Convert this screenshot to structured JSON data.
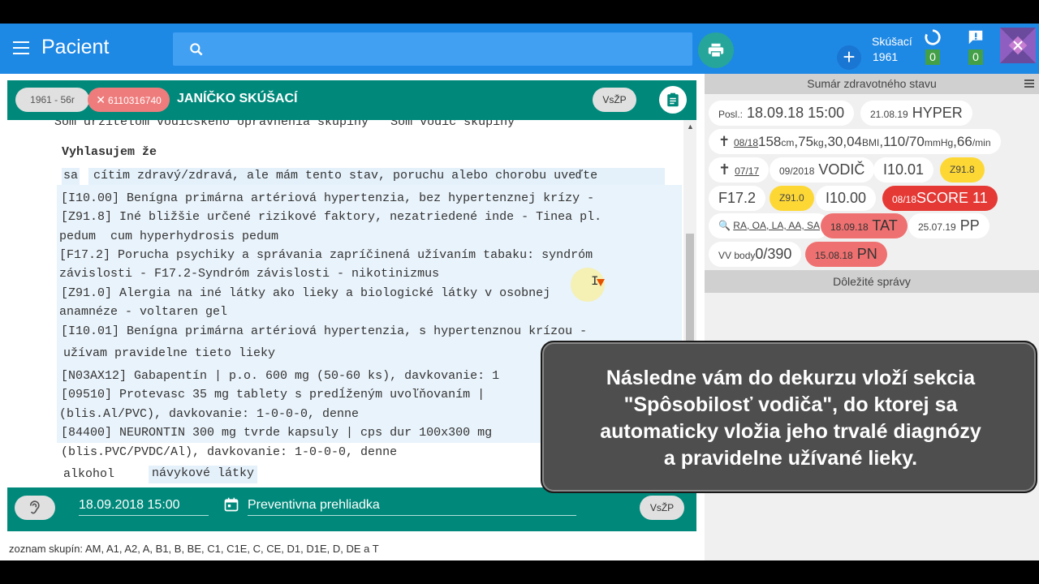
{
  "appbar": {
    "title": "Pacient",
    "add_label": "+",
    "user_name": "Skúšací",
    "user_id": "1961",
    "sync_count": "0",
    "message_count": "0",
    "icons": [
      "menu-icon",
      "search-icon",
      "print-icon",
      "sync-icon",
      "message-alert-icon",
      "app-logo"
    ]
  },
  "patient": {
    "age_chip": "1961 - 56r",
    "id_chip": "6110316740",
    "name": "JANÍČKO SKÚŠACÍ",
    "insurer": "VsŽP"
  },
  "editor": {
    "line_top": "Som držiteľom vodičského oprávnenia skupiny   Som vodič skupiny",
    "heading": "Vyhlasujem že",
    "sa": "sa",
    "feel": "cítim zdravý/zdravá, ale mám tento stav, poruchu alebo chorobu uveďte",
    "diag_lines": [
      "[I10.00] Benígna primárna artériová hypertenzia, bez hypertenznej krízy -",
      "[Z91.8] Iné bližšie určené rizikové faktory, nezatriedené inde - Tinea pl.",
      "pedum  cum hyperhydrosis pedum",
      "[F17.2] Porucha psychiky a správania zapríčinená užívaním tabaku: syndróm",
      "závislosti - F17.2-Syndróm závislosti - nikotinizmus",
      "[Z91.0] Alergia na iné látky ako lieky a biologické látky v osobnej",
      "anamnéze - voltaren gel",
      "[I10.01] Benígna primárna artériová hypertenzia, s hypertenznou krízou -"
    ],
    "regular_meds": "užívam pravidelne tieto lieky",
    "med_lines": [
      "[N03AX12] Gabapentín | p.o. 600 mg (50-60 ks), davkovanie: 1",
      "[09510] Protevasc 35 mg tablety s predĺženým uvoľňovaním |",
      "(blis.Al/PVC), davkovanie: 1-0-0-0, denne",
      "[84400] NEURONTIN 300 mg tvrde kapsuly | cps dur 100x300 mg",
      "(blis.PVC/PVDC/Al), davkovanie: 1-0-0-0, denne"
    ],
    "alcohol": "alkohol",
    "substances": "návykové látky"
  },
  "record": {
    "date": "18.09.2018 15:00",
    "type": "Preventivna prehliadka",
    "insurer": "VsŽP"
  },
  "groups_text": "zoznam skupín: AM, A1, A2, A, B1, B, BE, C1, C1E, C, CE, D1, D1E, D, DE a T",
  "summary": {
    "header": "Sumár zdravotného stavu",
    "important_header": "Dôležité správy",
    "last_label": "Posl.:",
    "last_value": "18.09.18 15:00",
    "hyper_date": "21.08.19",
    "hyper": "HYPER",
    "vitals_date": "08/18",
    "height": "158",
    "height_unit": "cm",
    "weight": "75",
    "weight_unit": "kg",
    "bmi": "30,04",
    "bmi_unit": "BMI",
    "bp": "110/70",
    "bp_unit": "mmHg",
    "pulse": "66",
    "pulse_unit": "/min",
    "cross_date": "07/17",
    "driver_date": "09/2018",
    "driver": "VODIČ",
    "diag_i1001": "I10.01",
    "diag_z918": "Z91.8",
    "diag_f172": "F17.2",
    "diag_z910": "Z91.0",
    "diag_i1000": "I10.00",
    "score_date": "08/18",
    "score": "SCORE 11",
    "lookup": "RA, OA, LA, AA, SA",
    "tat_date": "18.09.18",
    "tat": "TAT",
    "pp_date": "25.07.19",
    "pp": "PP",
    "vv_label": "VV body",
    "vv_value": "0/390",
    "pn_date": "15.08.18",
    "pn": "PN",
    "colors": {
      "yellow": "#fdd835",
      "salmon": "#ef7070",
      "red": "#e53935",
      "teal": "#00897b",
      "blue": "#1e88e5"
    }
  },
  "callout": {
    "lines": [
      "Následne vám do dekurzu vloží sekcia",
      "\"Spôsobilosť vodiča\", do ktorej sa",
      "automaticky vložia jeho trvalé diagnózy",
      "a pravidelne užívané lieky."
    ]
  }
}
